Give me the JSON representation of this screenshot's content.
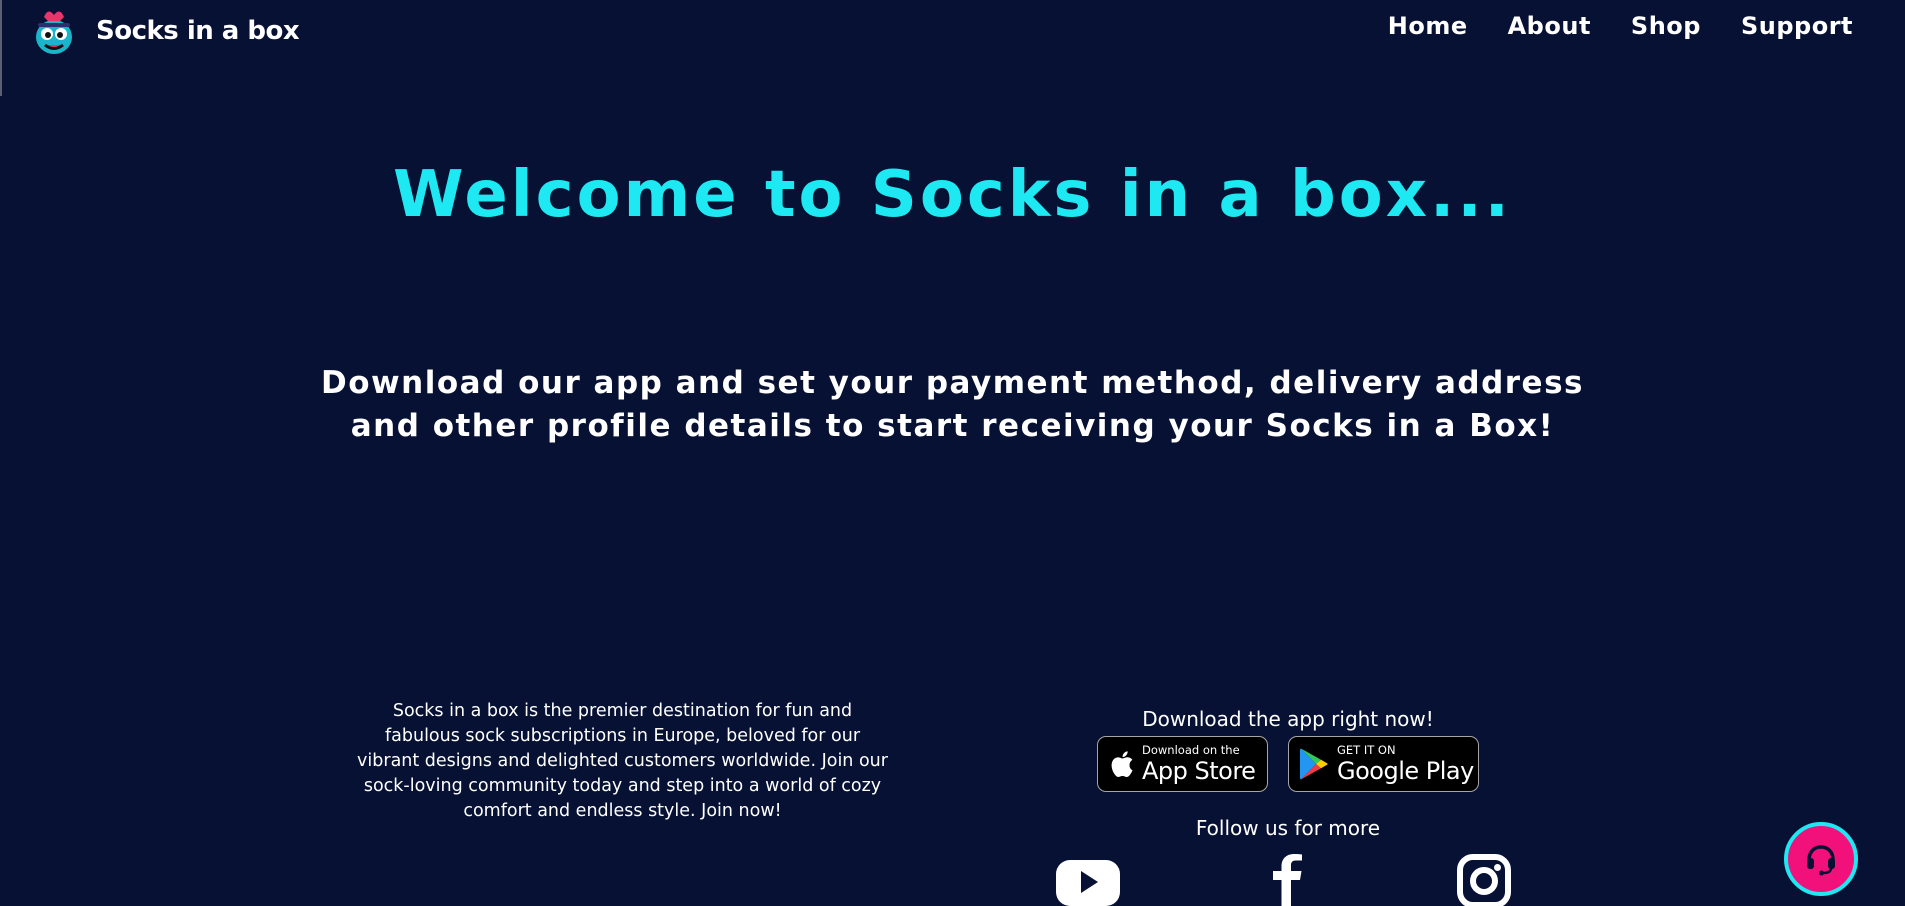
{
  "header": {
    "brand_name": "Socks in a box",
    "nav": [
      {
        "label": "Home"
      },
      {
        "label": "About"
      },
      {
        "label": "Shop"
      },
      {
        "label": "Support"
      }
    ]
  },
  "hero": {
    "title": "Welcome to Socks in a box...",
    "subtitle": "Download our app and set your payment method, delivery address and other profile details to start receiving your Socks in a Box!"
  },
  "footer": {
    "about_text": "Socks in a box is the premier destination for fun and fabulous sock subscriptions in Europe, beloved for our vibrant designs and delighted customers worldwide. Join our sock-loving community today and step into a world of cozy comfort and endless style. Join now!",
    "download_title": "Download the app right now!",
    "app_store": {
      "small": "Download on the",
      "big": "App Store"
    },
    "google_play": {
      "small": "GET IT ON",
      "big": "Google Play"
    },
    "follow_title": "Follow us for more",
    "social_icons": [
      "youtube-icon",
      "facebook-icon",
      "instagram-icon"
    ]
  },
  "support_button": {
    "icon": "headset-icon"
  },
  "colors": {
    "background": "#071133",
    "accent_cyan": "#1ee8f2",
    "support_pink": "#f2107a",
    "text": "#ffffff"
  }
}
